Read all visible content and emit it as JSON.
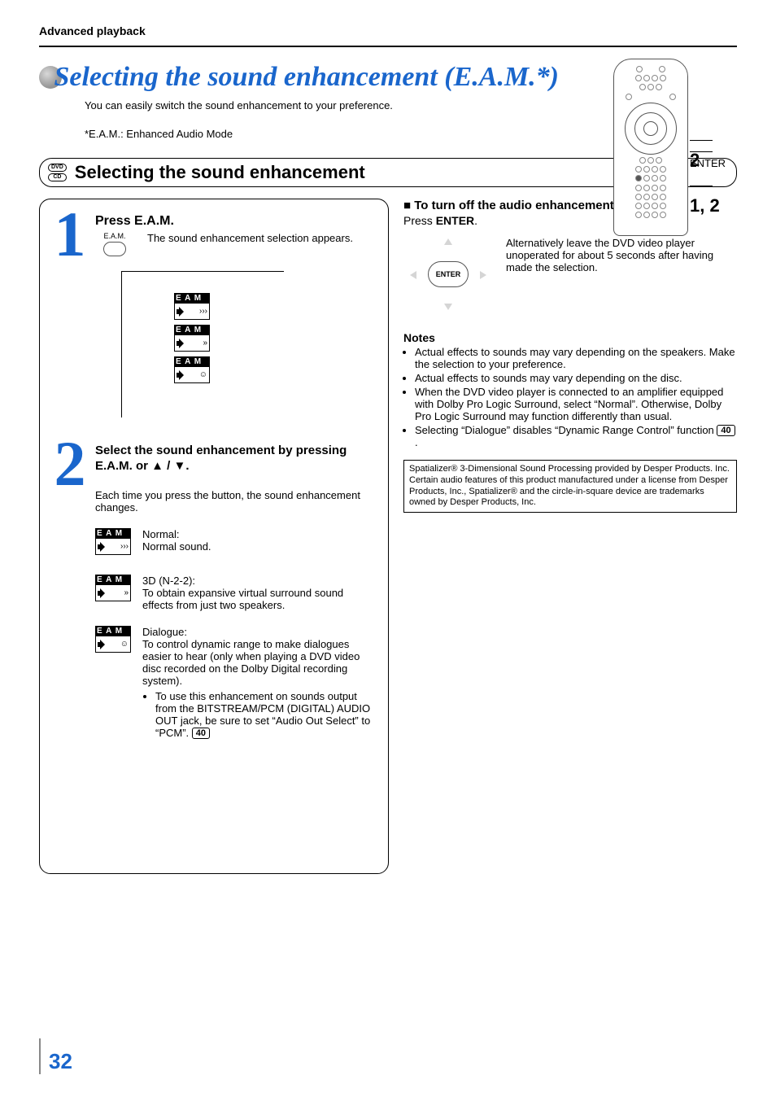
{
  "header": {
    "section": "Advanced playback"
  },
  "title": {
    "main": "Selecting the sound enhancement (E.A.M.*)",
    "sub": "You can easily switch the sound enhancement to your preference.",
    "footnote": "*E.A.M.: Enhanced Audio Mode"
  },
  "remote": {
    "label2": "2",
    "labelEnter": "ENTER",
    "label12": "1, 2"
  },
  "sectionbar": {
    "disc1": "DVD",
    "disc2": "CD",
    "title": "Selecting the sound enhancement"
  },
  "steps": {
    "s1": {
      "num": "1",
      "head": "Press E.A.M.",
      "btn_label": "E.A.M.",
      "text": "The sound enhancement selection appears.",
      "icon_label": "E A M"
    },
    "s2": {
      "num": "2",
      "head": "Select the sound enhancement by pressing E.A.M. or ▲ / ▼.",
      "text": "Each time you press the button, the sound enhancement changes.",
      "modes": [
        {
          "label": "E A M",
          "title": "Normal:",
          "desc": "Normal sound."
        },
        {
          "label": "E A M",
          "title": "3D (N-2-2):",
          "desc": "To obtain expansive virtual surround sound effects from just two speakers."
        },
        {
          "label": "E A M",
          "title": "Dialogue:",
          "desc": "To control dynamic range to make dialogues easier to hear (only when playing a DVD video disc recorded on the Dolby Digital recording system).",
          "bullet": "To use this enhancement on sounds output from the BITSTREAM/PCM (DIGITAL) AUDIO OUT jack, be sure to set “Audio Out Select” to “PCM”.",
          "pageref": "40"
        }
      ]
    }
  },
  "right": {
    "turnoff_head": "To turn off the audio enhancement selection",
    "turnoff_sub_pre": "Press ",
    "turnoff_sub_bold": "ENTER",
    "enter_btn": "ENTER",
    "enter_text": "Alternatively leave the DVD video player unoperated for about 5 seconds after having made the selection.",
    "notes_h": "Notes",
    "notes": [
      "Actual effects to sounds may vary depending on the speakers.  Make the selection to your preference.",
      "Actual effects to sounds may vary depending on the disc.",
      "When the DVD video player is connected to an amplifier equipped with Dolby Pro Logic Surround, select “Normal”. Otherwise, Dolby Pro Logic Surround may function differently than usual."
    ],
    "note_dialogue_pre": "Selecting “Dialogue” disables “Dynamic Range Control” function ",
    "note_dialogue_ref": "40",
    "legal": "Spatializer® 3-Dimensional Sound Processing provided by Desper Products. Inc.\nCertain audio features of this product manufactured under a license from Desper Products, Inc., Spatializer® and the circle-in-square device are trademarks owned by Desper Products, Inc."
  },
  "page_number": "32"
}
